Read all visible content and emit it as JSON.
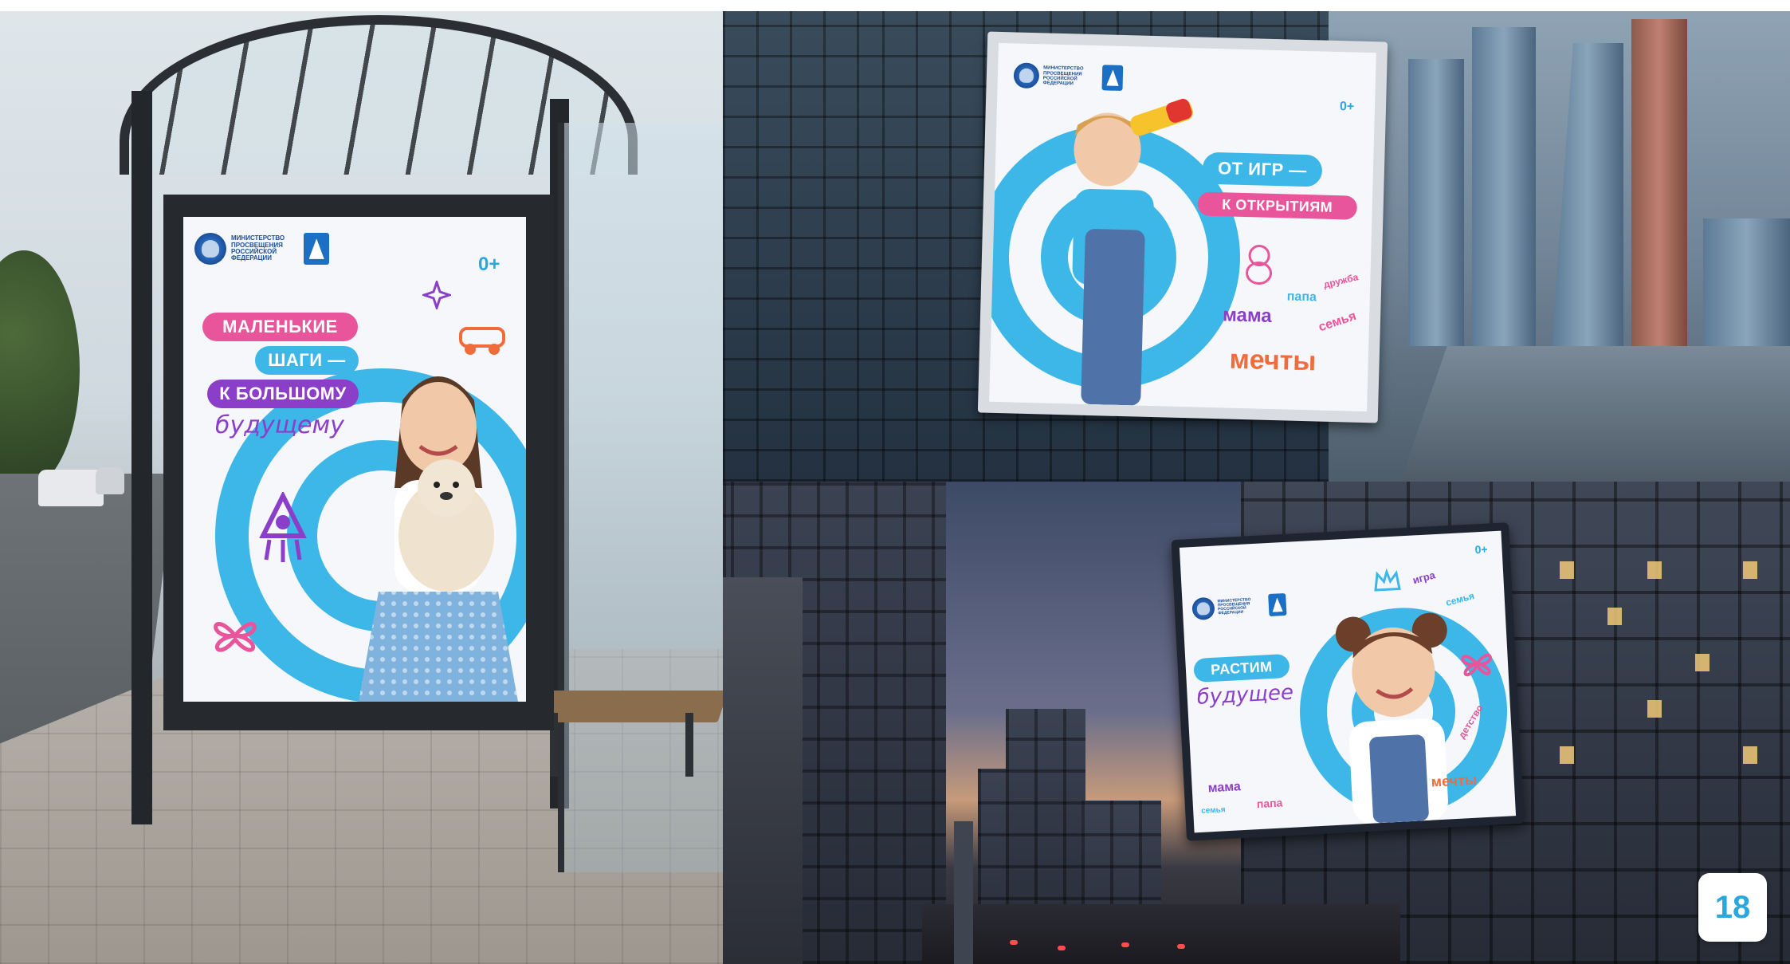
{
  "colors": {
    "accent_blue": "#3db7e8",
    "accent_pink": "#e8559b",
    "accent_purple": "#8b3fc9",
    "ministry_blue": "#1b4f99"
  },
  "ministry_logo_text": "Министерство\nпросвещения\nРоссийской\nФедерации",
  "icons": [
    "ministry-emblem-icon",
    "brand-triangle-icon"
  ],
  "posters": {
    "bus_stop": {
      "age": "0+",
      "line1": "Маленькие",
      "line2": "шаги —",
      "line3": "к большому",
      "script": "будущему"
    },
    "tower": {
      "age": "0+",
      "line1": "От игр —",
      "line2": "к открытиям",
      "doodles": [
        "мама",
        "папа",
        "семья",
        "дружба",
        "мечты"
      ]
    },
    "street": {
      "age": "0+",
      "line1": "Растим",
      "script": "будущее",
      "doodles": [
        "игра",
        "семья",
        "мечты",
        "детство",
        "мама",
        "папа",
        "семья"
      ]
    }
  },
  "page_number": "18"
}
